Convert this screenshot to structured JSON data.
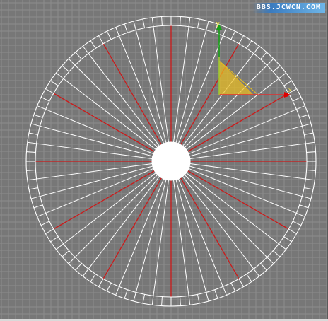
{
  "watermark": {
    "text": "BBS.JCWCN.COM"
  },
  "viewport": {
    "grid_color": "#8c8c8c",
    "background_color": "#777777",
    "wire_color": "#ffffff",
    "major_spoke_color": "#cc1a1a"
  },
  "wheel": {
    "spoke_count": 48,
    "major_spoke_every": 4
  },
  "gizmo": {
    "x_axis_color": "#e00000",
    "y_axis_color": "#18a018",
    "plane_color": "#f0c020",
    "handle_icon": "move-gizmo-icon"
  }
}
